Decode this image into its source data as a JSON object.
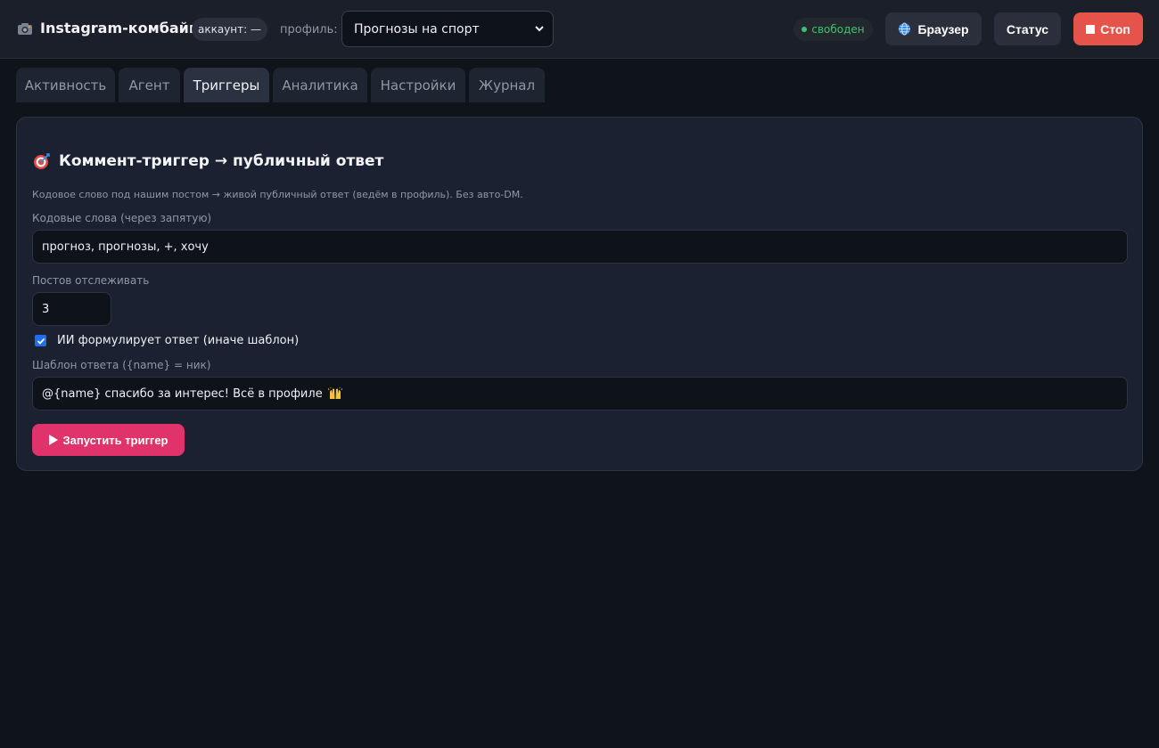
{
  "header": {
    "app_title": "Instagram-комбайн",
    "account": "аккаунт: —",
    "profile_label": "профиль:",
    "profile_value": "Прогнозы на спорт",
    "status": "свободен",
    "status_color": "#3ec26f",
    "browser_label": "Браузер",
    "status_label": "Статус",
    "stop_label": "Стоп",
    "stop_color": "#e5534b"
  },
  "tabs": [
    {
      "label": "Активность",
      "active": false
    },
    {
      "label": "Агент",
      "active": false
    },
    {
      "label": "Триггеры",
      "active": true
    },
    {
      "label": "Аналитика",
      "active": false
    },
    {
      "label": "Настройки",
      "active": false
    },
    {
      "label": "Журнал",
      "active": false
    }
  ],
  "trigger": {
    "title": "Коммент-триггер → публичный ответ",
    "description": "Кодовое слово под нашим постом → живой публичный ответ (ведём в профиль). Без авто-DM.",
    "keywords_label": "Кодовые слова (через запятую)",
    "keywords_value": "прогноз, прогнозы, +, хочу",
    "posts_label": "Постов отслеживать",
    "posts_value": "3",
    "ai_checkbox_label": "ИИ формулирует ответ (иначе шаблон)",
    "ai_checked": true,
    "template_label": "Шаблон ответа ({name} = ник)",
    "template_value": "@{name} спасибо за интерес! Всё в профиле",
    "run_label": "Запустить триггер",
    "run_color": "#e0336c"
  }
}
